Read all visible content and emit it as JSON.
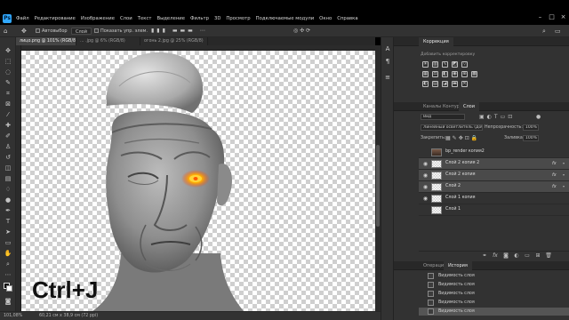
{
  "menu": {
    "logo": "Ps",
    "items": [
      "Файл",
      "Редактирование",
      "Изображение",
      "Слои",
      "Текст",
      "Выделение",
      "Фильтр",
      "3D",
      "Просмотр",
      "Подключаемые модули",
      "Окно",
      "Справка"
    ]
  },
  "options_bar": {
    "style_value": "Слой",
    "autoselect_label": "Автовыбор",
    "show_controls_label": "Показать упр. элем."
  },
  "doc_tabs": [
    {
      "label": "лицо.png @ 101% (RGB/8) *",
      "active": true
    },
    {
      "label": "... .jpg @ 6% (RGB/8)",
      "active": false
    },
    {
      "label": "огонь 2.jpg @ 25% (RGB/8)",
      "active": false
    }
  ],
  "canvas": {
    "overlay_text": "Ctrl+J"
  },
  "status": {
    "zoom": "101,08%",
    "doc_size": "60,21 см x 38,9 см (72 ppi)"
  },
  "adjustments": {
    "title": "Коррекция",
    "subtitle": "Добавить корректировку"
  },
  "layers_panel": {
    "tabs": [
      "Каналы",
      "Контуры",
      "Слои"
    ],
    "active_tab": "Слои",
    "filter_value": "Вид",
    "blend_mode": "Линейный осветлитель (Добавл...",
    "opacity_label": "Непрозрачность:",
    "opacity_value": "100%",
    "lock_label": "Закрепить:",
    "fill_label": "Заливка:",
    "fill_value": "100%",
    "layers": [
      {
        "name": "bp_render копия2",
        "fx": "",
        "selected": false,
        "photo": true
      },
      {
        "name": "Слой 2 копия 2",
        "fx": "fx",
        "selected": true,
        "photo": false
      },
      {
        "name": "Слой 2 копия",
        "fx": "fx",
        "selected": true,
        "photo": false
      },
      {
        "name": "Слой 2",
        "fx": "fx",
        "selected": true,
        "photo": false
      },
      {
        "name": "Слой 1 копия",
        "fx": "",
        "selected": false,
        "photo": false
      },
      {
        "name": "Слой 1",
        "fx": "",
        "selected": false,
        "photo": false
      }
    ]
  },
  "history_panel": {
    "tabs": [
      "Операции",
      "История"
    ],
    "active_tab": "История",
    "items": [
      "Видимость слоя",
      "Видимость слоя",
      "Видимость слоя",
      "Видимость слоя",
      "Видимость слоя"
    ]
  }
}
